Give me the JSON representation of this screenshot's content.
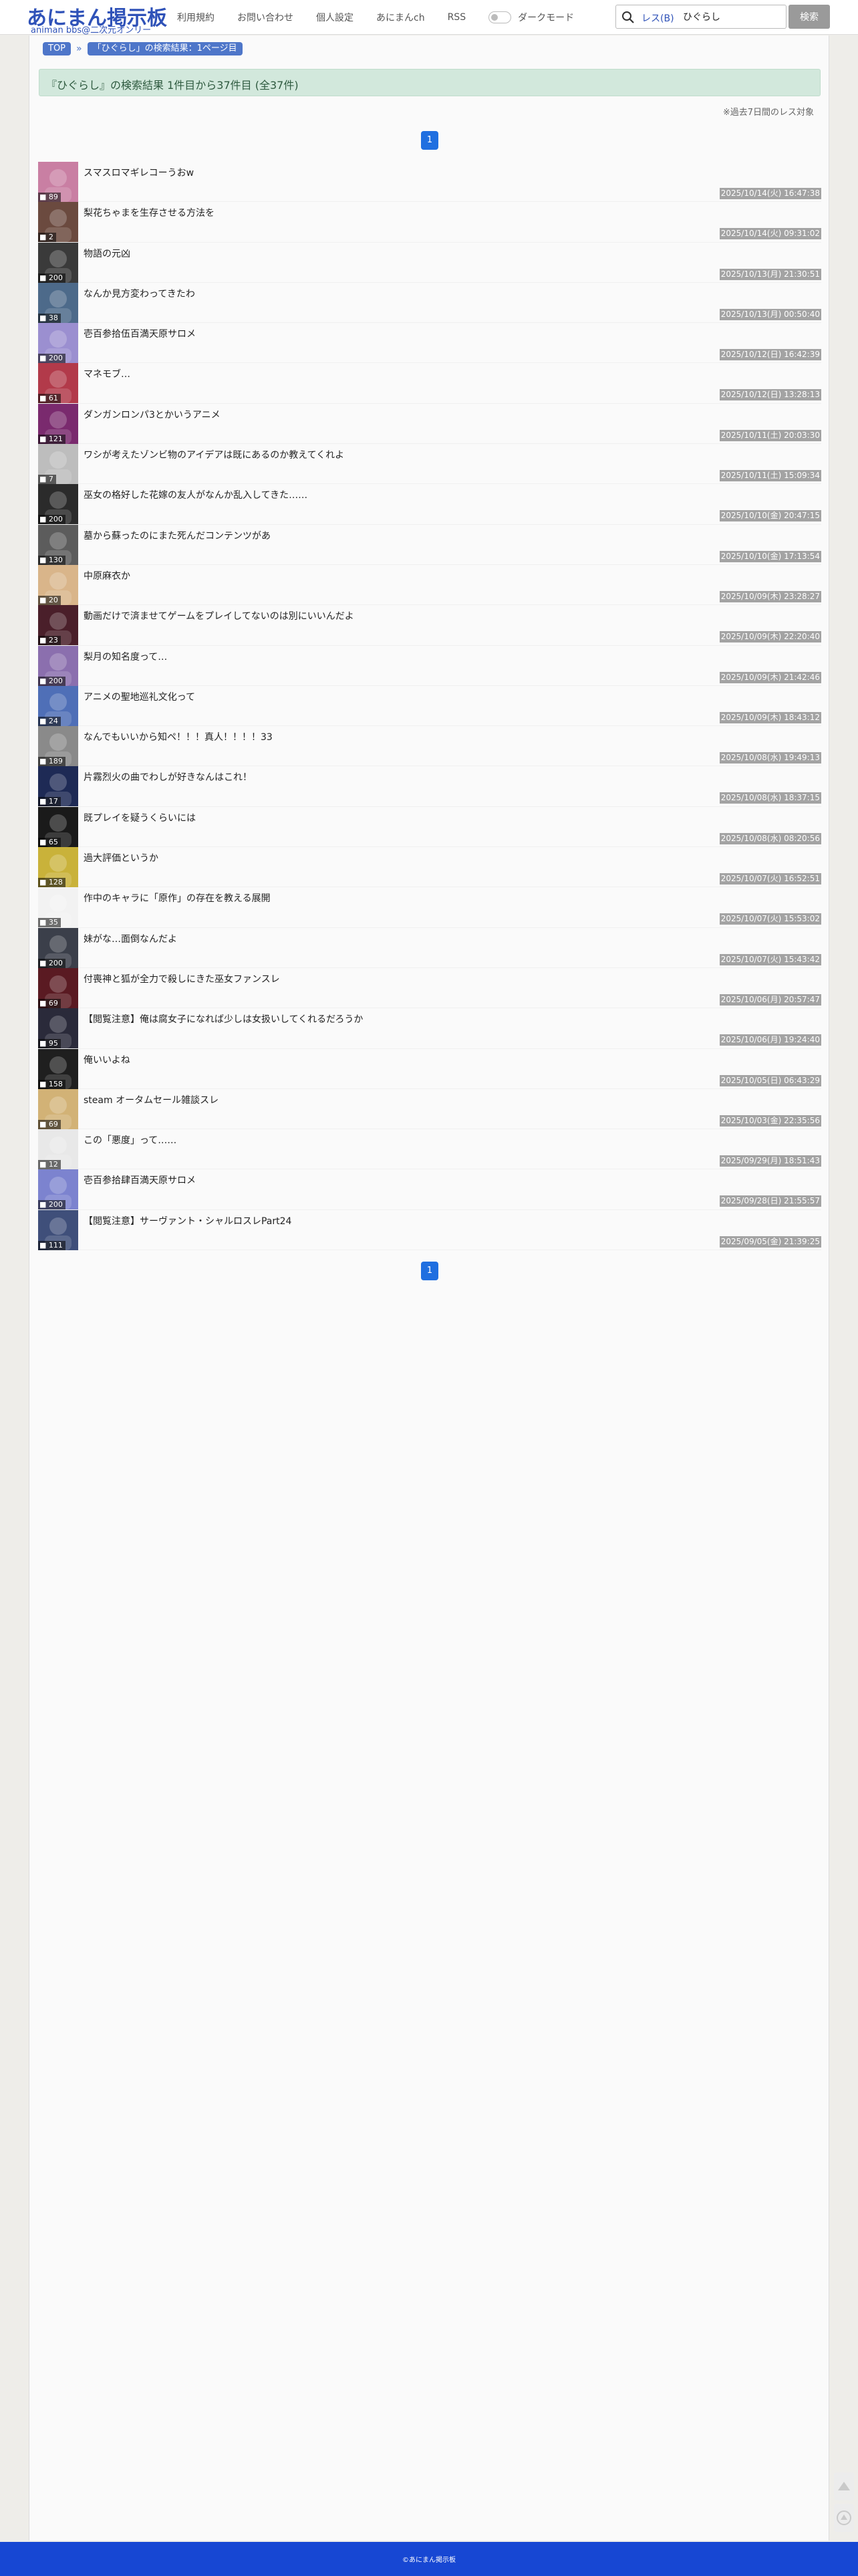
{
  "header": {
    "logo_main": "あにまん掲示板",
    "logo_sub": "animan bbs@二次元オンリー",
    "nav": [
      "利用規約",
      "お問い合わせ",
      "個人設定",
      "あにまんch",
      "RSS"
    ],
    "dark_mode_label": "ダークモード",
    "search_mode_label": "レス(B)",
    "search_value": "ひぐらし",
    "search_button": "検索"
  },
  "breadcrumb": {
    "top": "TOP",
    "separator": "»",
    "current": "「ひぐらし」の検索結果：1ページ目"
  },
  "result_summary": "『ひぐらし』の検索結果 1件目から37件目 (全37件)",
  "note": "※過去7日間のレス対象",
  "pagination": {
    "current_page": "1"
  },
  "threads": [
    {
      "title": "スマスロマギレコーうおw",
      "count": "89",
      "date": "2025/10/14(火) 16:47:38",
      "thumb": "#c97fa3"
    },
    {
      "title": "梨花ちゃまを生存させる方法を",
      "count": "2",
      "date": "2025/10/14(火) 09:31:02",
      "thumb": "#6b4a3f"
    },
    {
      "title": "物語の元凶",
      "count": "200",
      "date": "2025/10/13(月) 21:30:51",
      "thumb": "#3a3a3a"
    },
    {
      "title": "なんか見方変わってきたわ",
      "count": "38",
      "date": "2025/10/13(月) 00:50:40",
      "thumb": "#4d6a8a"
    },
    {
      "title": "壱百参拾伍百満天原サロメ",
      "count": "200",
      "date": "2025/10/12(日) 16:42:39",
      "thumb": "#9b8fd0"
    },
    {
      "title": "マネモブ…",
      "count": "61",
      "date": "2025/10/12(日) 13:28:13",
      "thumb": "#b23a4a"
    },
    {
      "title": "ダンガンロンパ3とかいうアニメ",
      "count": "121",
      "date": "2025/10/11(土) 20:03:30",
      "thumb": "#7a2a6e"
    },
    {
      "title": "ワシが考えたゾンビ物のアイデアは既にあるのか教えてくれよ",
      "count": "7",
      "date": "2025/10/11(土) 15:09:34",
      "thumb": "#bdbdbd"
    },
    {
      "title": "巫女の格好した花嫁の友人がなんか乱入してきた……",
      "count": "200",
      "date": "2025/10/10(金) 20:47:15",
      "thumb": "#2b2b2b"
    },
    {
      "title": "墓から蘇ったのにまた死んだコンテンツがあ",
      "count": "130",
      "date": "2025/10/10(金) 17:13:54",
      "thumb": "#5c5c5c"
    },
    {
      "title": "中原麻衣か",
      "count": "20",
      "date": "2025/10/09(木) 23:28:27",
      "thumb": "#d9b58a"
    },
    {
      "title": "動画だけで済ませてゲームをプレイしてないのは別にいいんだよ",
      "count": "23",
      "date": "2025/10/09(木) 22:20:40",
      "thumb": "#4a1f2a"
    },
    {
      "title": "梨月の知名度って…",
      "count": "200",
      "date": "2025/10/09(木) 21:42:46",
      "thumb": "#8b6fae"
    },
    {
      "title": "アニメの聖地巡礼文化って",
      "count": "24",
      "date": "2025/10/09(木) 18:43:12",
      "thumb": "#4f6fb7"
    },
    {
      "title": "なんでもいいから知ペ！！！真人！！！！33",
      "count": "189",
      "date": "2025/10/08(水) 19:49:13",
      "thumb": "#8a8a8a"
    },
    {
      "title": "片霧烈火の曲でわしが好きなんはこれ！",
      "count": "17",
      "date": "2025/10/08(水) 18:37:15",
      "thumb": "#1e2a55"
    },
    {
      "title": "既プレイを疑うくらいには",
      "count": "65",
      "date": "2025/10/08(水) 08:20:56",
      "thumb": "#1a1a1a"
    },
    {
      "title": "過大評価というか",
      "count": "128",
      "date": "2025/10/07(火) 16:52:51",
      "thumb": "#c9b23a"
    },
    {
      "title": "作中のキャラに「原作」の存在を教える展開",
      "count": "35",
      "date": "2025/10/07(火) 15:53:02",
      "thumb": "#f2f2f2"
    },
    {
      "title": "妹がな…面倒なんだよ",
      "count": "200",
      "date": "2025/10/07(火) 15:43:42",
      "thumb": "#3b3f4a"
    },
    {
      "title": "付喪神と狐が全力で殺しにきた巫女ファンスレ",
      "count": "69",
      "date": "2025/10/06(月) 20:57:47",
      "thumb": "#5a1a22"
    },
    {
      "title": "【閲覧注意】俺は腐女子になれば少しは女扱いしてくれるだろうか",
      "count": "95",
      "date": "2025/10/06(月) 19:24:40",
      "thumb": "#2a2a3a"
    },
    {
      "title": "俺いいよね",
      "count": "158",
      "date": "2025/10/05(日) 06:43:29",
      "thumb": "#1f1f1f"
    },
    {
      "title": "steam オータムセール雑談スレ",
      "count": "69",
      "date": "2025/10/03(金) 22:35:56",
      "thumb": "#d2b276"
    },
    {
      "title": "この「悪度」って……",
      "count": "12",
      "date": "2025/09/29(月) 18:51:43",
      "thumb": "#e8e8e8"
    },
    {
      "title": "壱百参拾肆百満天原サロメ",
      "count": "200",
      "date": "2025/09/28(日) 21:55:57",
      "thumb": "#7c83cf"
    },
    {
      "title": "【閲覧注意】サーヴァント・シャルロスレPart24",
      "count": "111",
      "date": "2025/09/05(金) 21:39:25",
      "thumb": "#3f4f7a"
    }
  ],
  "footer": {
    "text": "©あにまん掲示板"
  }
}
